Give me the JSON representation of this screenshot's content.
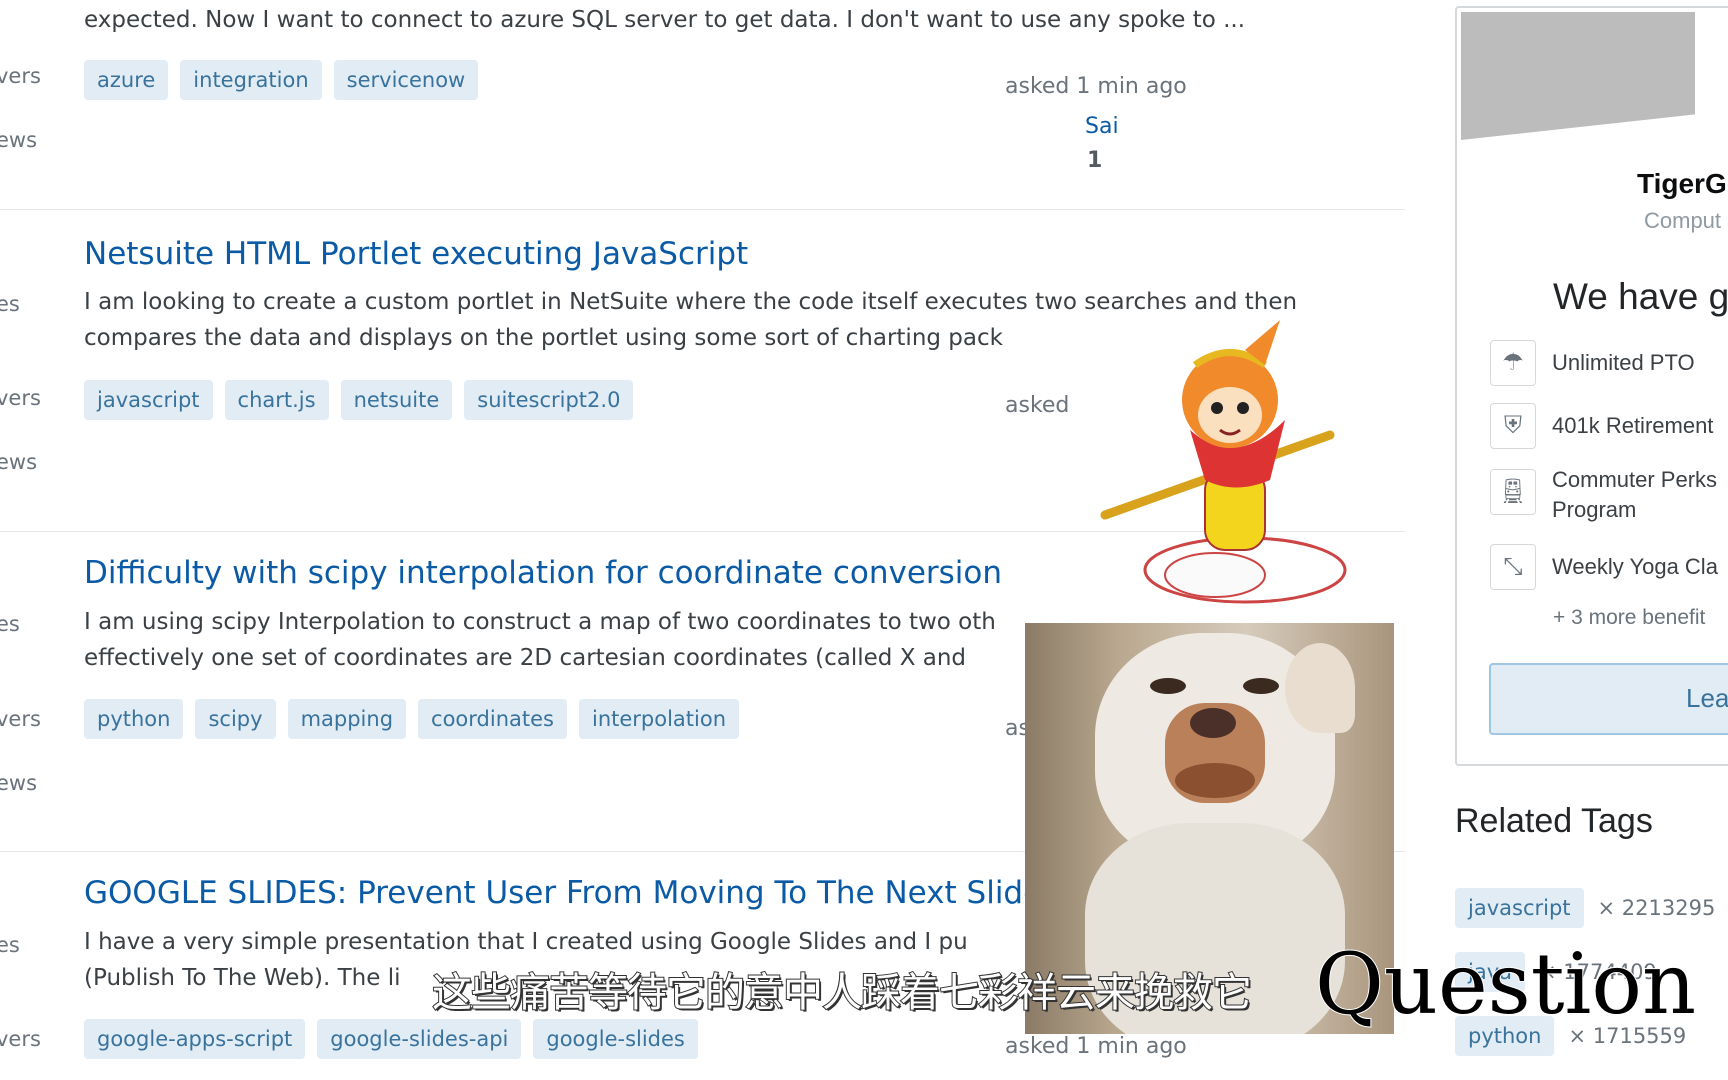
{
  "left_stats": [
    "vers",
    "ews",
    "es",
    "vers",
    "ews",
    "es",
    "vers",
    "ews",
    "es",
    "vers"
  ],
  "questions": [
    {
      "excerpt": [
        "expected. Now I want to connect to azure SQL server to get data. I don't want to use any spoke to ..."
      ],
      "tags": [
        "azure",
        "integration",
        "servicenow"
      ],
      "asked": "asked 1 min ago",
      "user": "Sai",
      "rep": "1"
    },
    {
      "title": "Netsuite HTML Portlet executing JavaScript",
      "excerpt": [
        "I am looking to create a custom portlet in NetSuite where the code itself executes two searches and then",
        "compares the data and displays on the portlet using some sort of charting pack"
      ],
      "tags": [
        "javascript",
        "chart.js",
        "netsuite",
        "suitescript2.0"
      ],
      "asked": "asked"
    },
    {
      "title": "Difficulty with scipy interpolation for coordinate conversion",
      "excerpt": [
        "I am using scipy Interpolation to construct a map of two coordinates to two oth",
        "effectively one set of coordinates are 2D cartesian coordinates (called X and"
      ],
      "tags": [
        "python",
        "scipy",
        "mapping",
        "coordinates",
        "interpolation"
      ],
      "asked": "as"
    },
    {
      "title": "GOOGLE SLIDES: Prevent User From Moving To The Next Slide",
      "excerpt": [
        "I have a very simple presentation that I created using Google Slides and I pu",
        "(Publish To The Web). The li"
      ],
      "tags": [
        "google-apps-script",
        "google-slides-api",
        "google-slides"
      ],
      "asked": "asked 1 min ago"
    }
  ],
  "job_ad": {
    "company": "TigerG",
    "industry": "Comput",
    "headline": "We have g",
    "benefits": [
      {
        "icon": "umbrella-icon",
        "label": "Unlimited PTO"
      },
      {
        "icon": "shield-plus-icon",
        "label": "401k Retirement"
      },
      {
        "icon": "train-icon",
        "label": "Commuter Perks\nProgram"
      },
      {
        "icon": "yoga-icon",
        "label": "Weekly Yoga Cla"
      }
    ],
    "more": "+ 3 more benefit",
    "button": "Lea"
  },
  "related_tags": {
    "heading": "Related Tags",
    "items": [
      {
        "tag": "javascript",
        "count": "× 2213295"
      },
      {
        "tag": "java",
        "count": "× 1774409"
      },
      {
        "tag": "python",
        "count": "× 1715559"
      }
    ]
  },
  "overlay": {
    "subtitle": "这些痛苦等待它的意中人踩着七彩祥云来挽救它",
    "watermark": "Question"
  },
  "colors": {
    "link": "#0a5aa5",
    "tag_bg": "#e1ecf4",
    "tag_text": "#39739d"
  }
}
